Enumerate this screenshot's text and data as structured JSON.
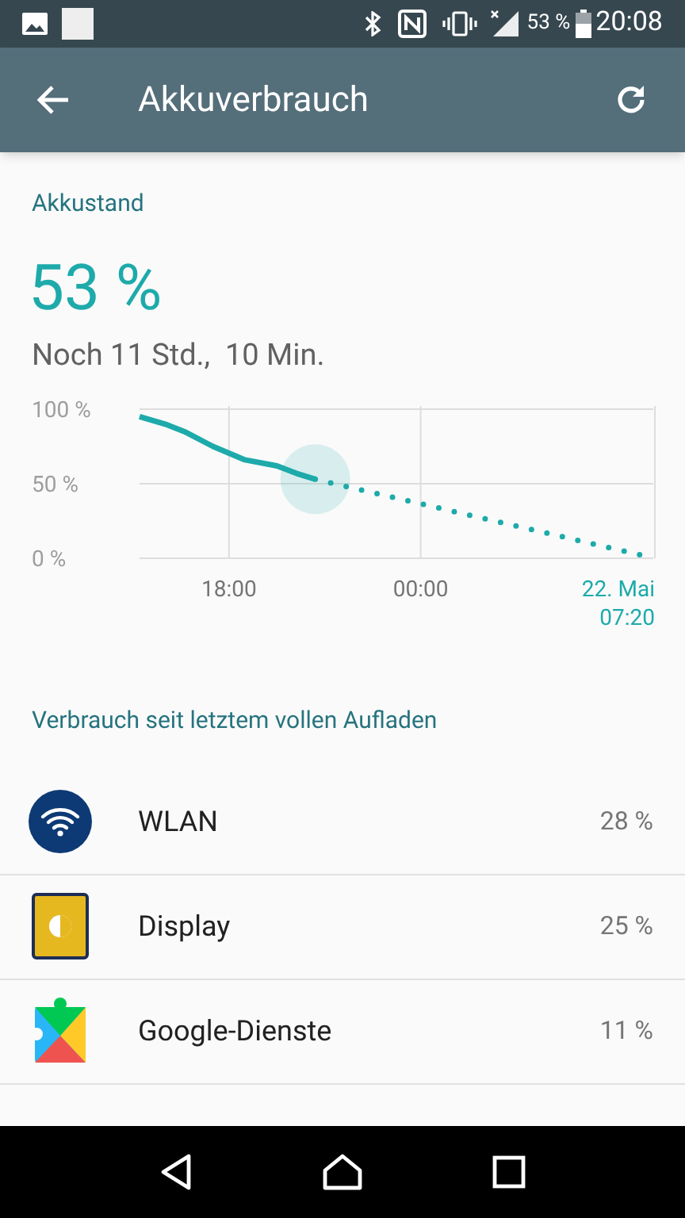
{
  "status_bar": {
    "battery": "53 %",
    "time": "20:08"
  },
  "toolbar": {
    "title": "Akkuverbrauch"
  },
  "battery_state": {
    "heading": "Akkustand",
    "percent": "53 %",
    "remaining": "Noch 11 Std.,  10 Min.",
    "chart_data": {
      "type": "line",
      "x": [
        15.2,
        16,
        16.6,
        17.5,
        18.5,
        19.5,
        20.1,
        20.7,
        31.33
      ],
      "series": [
        {
          "color": "#1eaaaa",
          "line_style": "solid",
          "values": [
            95,
            90,
            85,
            75,
            66,
            62,
            57,
            53,
            null
          ]
        },
        {
          "color": "#1eaaaa",
          "line_style": "dotted",
          "values": [
            null,
            null,
            null,
            null,
            null,
            null,
            null,
            53,
            0
          ]
        }
      ],
      "grid": true,
      "xlim": [
        15.2,
        31.33
      ],
      "ylim": [
        0,
        100
      ],
      "yticks": [
        {
          "value": 0,
          "label": "0 %"
        },
        {
          "value": 50,
          "label": "50 %"
        },
        {
          "value": 100,
          "label": "100 %"
        }
      ],
      "xticks": [
        {
          "value": 18,
          "label": "18:00"
        },
        {
          "value": 24,
          "label": "00:00"
        },
        {
          "value": 31.33,
          "label": "22. Mai 07:20"
        }
      ]
    }
  },
  "usage": {
    "heading": "Verbrauch seit letztem vollen Aufladen",
    "items": [
      {
        "kind": "wifi",
        "name": "WLAN",
        "percent": "28 %"
      },
      {
        "kind": "display",
        "name": "Display",
        "percent": "25 %"
      },
      {
        "kind": "services",
        "name": "Google-Dienste",
        "percent": "11 %"
      }
    ]
  }
}
